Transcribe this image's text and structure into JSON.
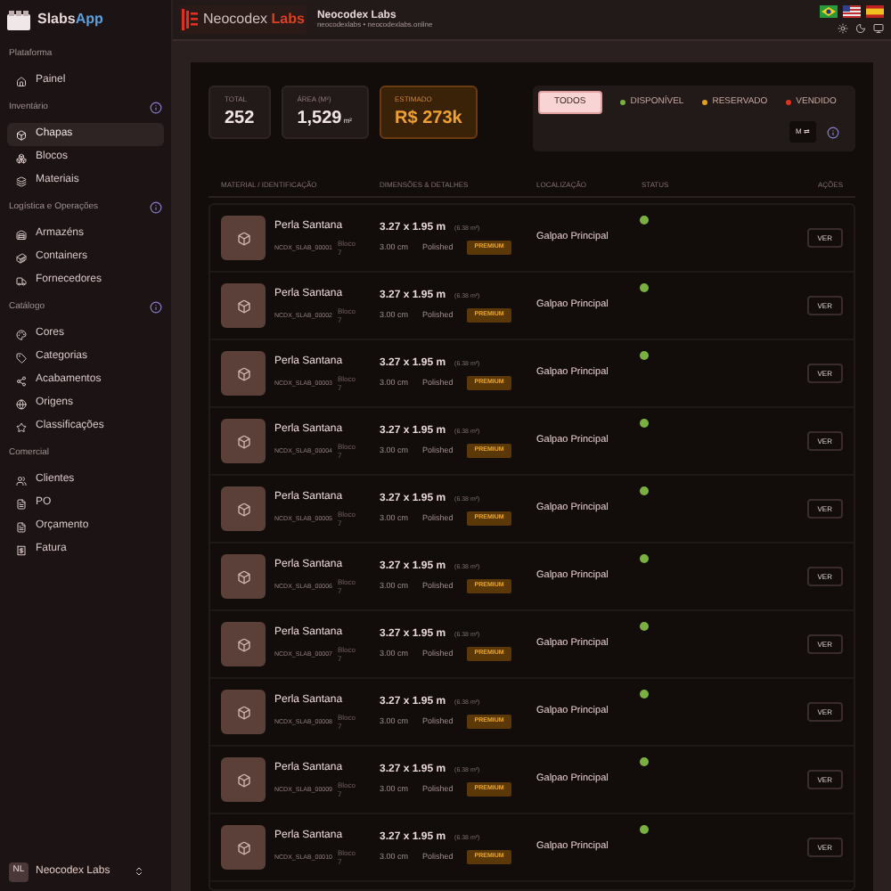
{
  "sidebar": {
    "brand": {
      "name": "Slabs",
      "accent": "App"
    },
    "sections": [
      {
        "title": "Plataforma",
        "info": false,
        "items": [
          {
            "label": "Painel",
            "selected": false
          }
        ]
      },
      {
        "title": "Inventário",
        "info": true,
        "items": [
          {
            "label": "Chapas",
            "selected": true
          },
          {
            "label": "Blocos",
            "selected": false
          },
          {
            "label": "Materiais",
            "selected": false
          }
        ]
      },
      {
        "title": "Logística e Operações",
        "info": true,
        "items": [
          {
            "label": "Armazéns",
            "selected": false
          },
          {
            "label": "Containers",
            "selected": false
          },
          {
            "label": "Fornecedores",
            "selected": false
          }
        ]
      },
      {
        "title": "Catálogo",
        "info": true,
        "items": [
          {
            "label": "Cores",
            "selected": false
          },
          {
            "label": "Categorias",
            "selected": false
          },
          {
            "label": "Acabamentos",
            "selected": false
          },
          {
            "label": "Origens",
            "selected": false
          },
          {
            "label": "Classificações",
            "selected": false
          }
        ]
      },
      {
        "title": "Comercial",
        "info": false,
        "items": [
          {
            "label": "Clientes",
            "selected": false
          },
          {
            "label": "PO",
            "selected": false
          },
          {
            "label": "Orçamento",
            "selected": false
          },
          {
            "label": "Fatura",
            "selected": false
          }
        ]
      }
    ],
    "account": {
      "initials": "NL",
      "name": "Neocodex Labs"
    }
  },
  "header": {
    "logo": {
      "name": "Neocodex",
      "accent": "Labs"
    },
    "company": "Neocodex Labs",
    "subtitle": "neocodexlabs • neocodexlabs.online"
  },
  "stats": [
    {
      "label": "TOTAL",
      "value": "252",
      "highlight": false
    },
    {
      "label": "ÁREA (M²)",
      "value": "1,529",
      "unit": "m²",
      "highlight": false
    },
    {
      "label": "ESTIMADO",
      "value": "R$ 273k",
      "highlight": true
    }
  ],
  "filters": [
    {
      "label": "TODOS",
      "selected": true
    },
    {
      "label": "DISPONÍVEL",
      "selected": false,
      "color": "#7ab040"
    },
    {
      "label": "RESERVADO",
      "selected": false,
      "color": "#e0a020"
    },
    {
      "label": "VENDIDO",
      "selected": false,
      "color": "#e03020"
    }
  ],
  "toggle": "M ⇄",
  "table": {
    "columns": [
      "MATERIAL / IDENTIFICAÇÃO",
      "DIMENSÕES & DETALHES",
      "LOCALIZAÇÃO",
      "STATUS",
      "AÇÕES"
    ],
    "rows": [
      {
        "name": "Perla Santana",
        "code": "NCDX_SLAB_00001",
        "block": "Bloco 7",
        "dims": "3.27 x 1.95 m",
        "area": "(6.38 m²)",
        "thickness": "3.00 cm",
        "finish": "Polished",
        "grade": "PREMIUM",
        "location": "Galpao Principal",
        "color": "#7ab040",
        "action": "VER"
      },
      {
        "name": "Perla Santana",
        "code": "NCDX_SLAB_00002",
        "block": "Bloco 7",
        "dims": "3.27 x 1.95 m",
        "area": "(6.38 m²)",
        "thickness": "3.00 cm",
        "finish": "Polished",
        "grade": "PREMIUM",
        "location": "Galpao Principal",
        "color": "#7ab040",
        "action": "VER"
      },
      {
        "name": "Perla Santana",
        "code": "NCDX_SLAB_00003",
        "block": "Bloco 7",
        "dims": "3.27 x 1.95 m",
        "area": "(6.38 m²)",
        "thickness": "3.00 cm",
        "finish": "Polished",
        "grade": "PREMIUM",
        "location": "Galpao Principal",
        "color": "#7ab040",
        "action": "VER"
      },
      {
        "name": "Perla Santana",
        "code": "NCDX_SLAB_00004",
        "block": "Bloco 7",
        "dims": "3.27 x 1.95 m",
        "area": "(6.38 m²)",
        "thickness": "3.00 cm",
        "finish": "Polished",
        "grade": "PREMIUM",
        "location": "Galpao Principal",
        "color": "#7ab040",
        "action": "VER"
      },
      {
        "name": "Perla Santana",
        "code": "NCDX_SLAB_00005",
        "block": "Bloco 7",
        "dims": "3.27 x 1.95 m",
        "area": "(6.38 m²)",
        "thickness": "3.00 cm",
        "finish": "Polished",
        "grade": "PREMIUM",
        "location": "Galpao Principal",
        "color": "#7ab040",
        "action": "VER"
      },
      {
        "name": "Perla Santana",
        "code": "NCDX_SLAB_00006",
        "block": "Bloco 7",
        "dims": "3.27 x 1.95 m",
        "area": "(6.38 m²)",
        "thickness": "3.00 cm",
        "finish": "Polished",
        "grade": "PREMIUM",
        "location": "Galpao Principal",
        "color": "#7ab040",
        "action": "VER"
      },
      {
        "name": "Perla Santana",
        "code": "NCDX_SLAB_00007",
        "block": "Bloco 7",
        "dims": "3.27 x 1.95 m",
        "area": "(6.38 m²)",
        "thickness": "3.00 cm",
        "finish": "Polished",
        "grade": "PREMIUM",
        "location": "Galpao Principal",
        "color": "#7ab040",
        "action": "VER"
      },
      {
        "name": "Perla Santana",
        "code": "NCDX_SLAB_00008",
        "block": "Bloco 7",
        "dims": "3.27 x 1.95 m",
        "area": "(6.38 m²)",
        "thickness": "3.00 cm",
        "finish": "Polished",
        "grade": "PREMIUM",
        "location": "Galpao Principal",
        "color": "#7ab040",
        "action": "VER"
      },
      {
        "name": "Perla Santana",
        "code": "NCDX_SLAB_00009",
        "block": "Bloco 7",
        "dims": "3.27 x 1.95 m",
        "area": "(6.38 m²)",
        "thickness": "3.00 cm",
        "finish": "Polished",
        "grade": "PREMIUM",
        "location": "Galpao Principal",
        "color": "#7ab040",
        "action": "VER"
      },
      {
        "name": "Perla Santana",
        "code": "NCDX_SLAB_00010",
        "block": "Bloco 7",
        "dims": "3.27 x 1.95 m",
        "area": "(6.38 m²)",
        "thickness": "3.00 cm",
        "finish": "Polished",
        "grade": "PREMIUM",
        "location": "Galpao Principal",
        "color": "#7ab040",
        "action": "VER"
      }
    ]
  }
}
